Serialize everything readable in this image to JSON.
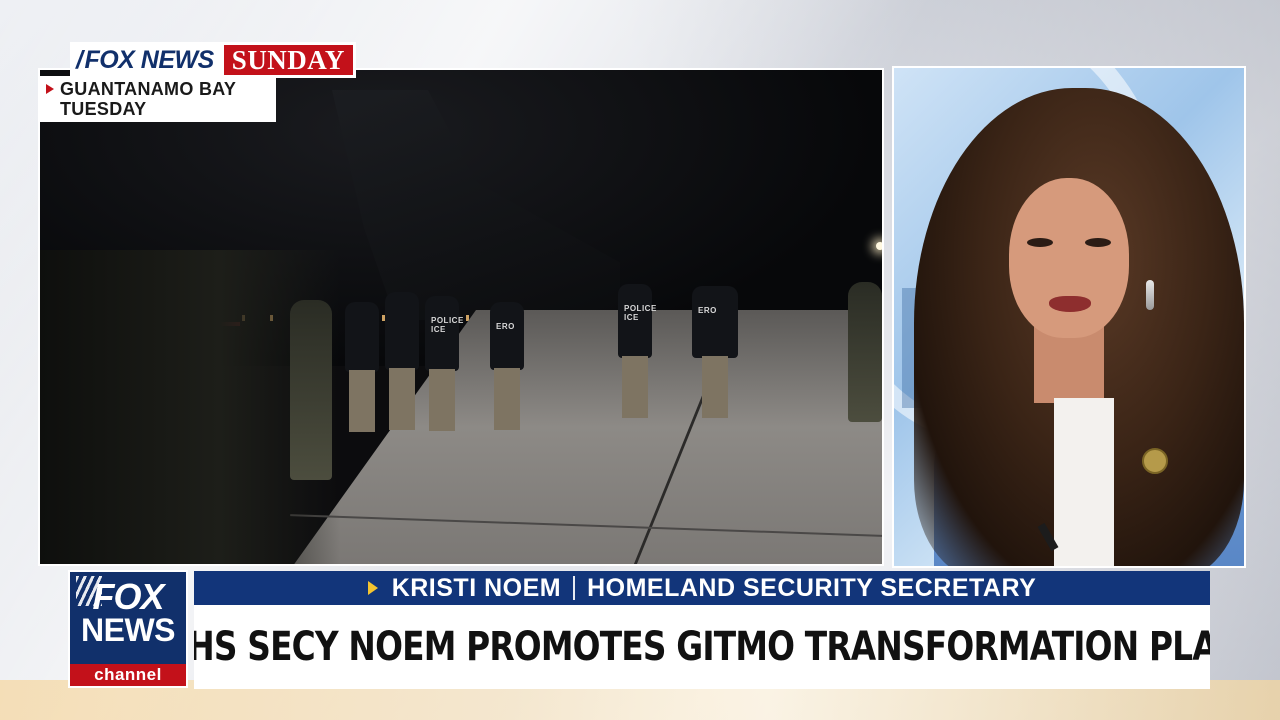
{
  "brand": {
    "network": "FOX NEWS",
    "show": "SUNDAY"
  },
  "location_tag": {
    "place": "GUANTANAMO BAY",
    "day": "TUESDAY"
  },
  "footage": {
    "vest_labels": [
      "POLICE ICE",
      "ERO",
      "POLICE ICE",
      "ERO"
    ]
  },
  "logo": {
    "line1": "FOX",
    "line2": "NEWS",
    "line3": "channel"
  },
  "lower_third": {
    "guest_name": "KRISTI NOEM",
    "guest_title": "HOMELAND SECURITY SECRETARY",
    "headline": "DHS SECY NOEM PROMOTES GITMO TRANSFORMATION PLAN"
  },
  "colors": {
    "fox_blue": "#11306b",
    "fox_red": "#c3111a",
    "nameplate_blue": "#12357a",
    "accent_yellow": "#f4c430"
  },
  "icons": {
    "location_marker": "triangle-right-icon",
    "name_marker": "triangle-right-icon"
  }
}
